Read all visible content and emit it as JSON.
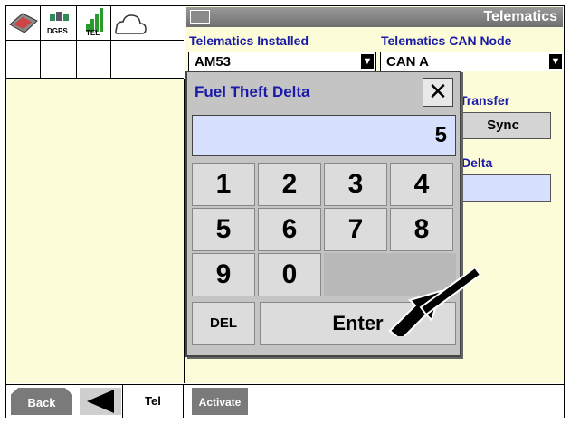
{
  "status_icons": {
    "dgps_label": "DGPS",
    "tel_label": "TEL"
  },
  "window": {
    "title": "Telematics"
  },
  "fields": {
    "telematics_installed": {
      "label": "Telematics Installed",
      "value": "AM53"
    },
    "telematics_can_node": {
      "label": "Telematics CAN Node",
      "value": "CAN A"
    },
    "transfer_label": "Transfer",
    "sync_label": "Sync",
    "delta_label": "Delta"
  },
  "dialog": {
    "title": "Fuel Theft Delta",
    "close_symbol": "✕",
    "value": "5",
    "keys": [
      "1",
      "2",
      "3",
      "4",
      "5",
      "6",
      "7",
      "8",
      "9",
      "0"
    ],
    "del_label": "DEL",
    "enter_label": "Enter"
  },
  "tabs": {
    "back_label": "Back",
    "tel_label": "Tel",
    "activate_label": "Activate"
  },
  "colors": {
    "panel_bg": "#fcfcd8",
    "label_blue": "#1a1aa8",
    "input_bg": "#d8e0ff"
  }
}
